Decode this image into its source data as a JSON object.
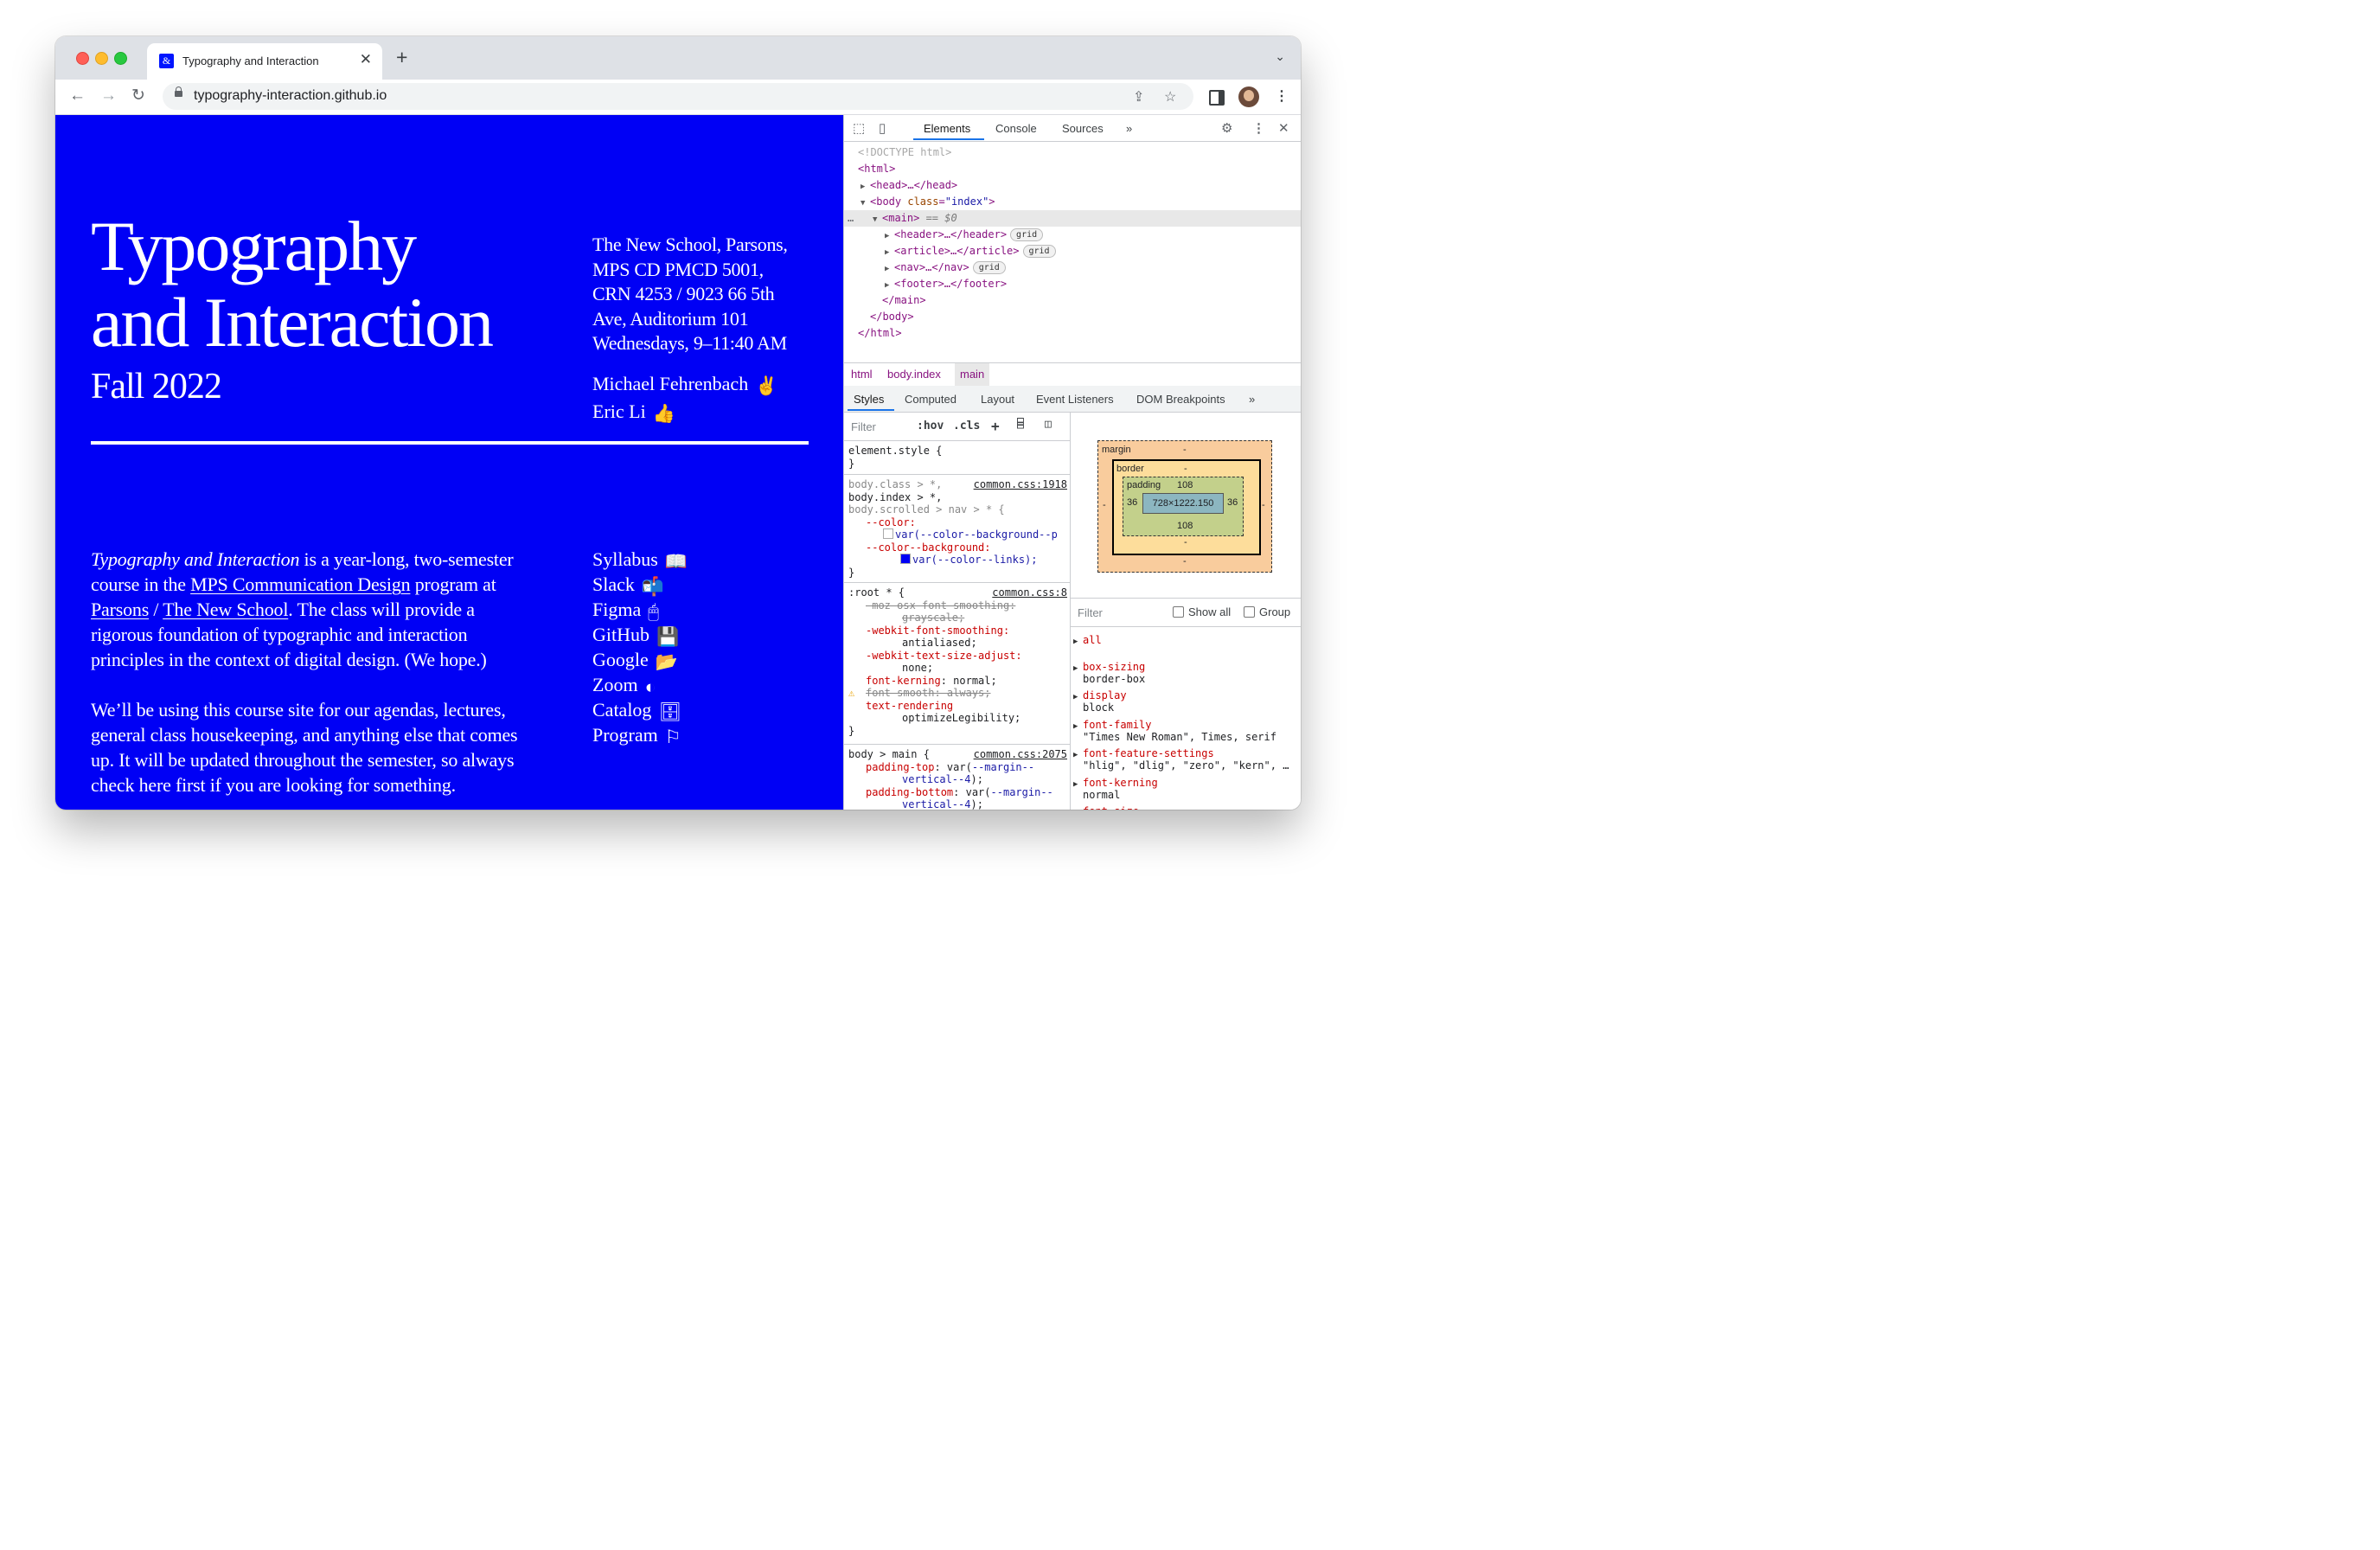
{
  "browser": {
    "tab_title": "Typography and Interaction",
    "tab_favicon": "&",
    "tab_close": "✕",
    "new_tab": "+",
    "tab_menu": "⌄",
    "url": "typography-interaction.github.io",
    "icons": [
      "back-icon",
      "forward-icon",
      "reload-icon",
      "lock-icon",
      "share-icon",
      "bookmark-star-icon",
      "sidebar-icon",
      "avatar",
      "kebab-menu-icon"
    ]
  },
  "page": {
    "title_line1": "Typography",
    "title_line2": "and Interaction",
    "subtitle": "Fall 2022",
    "info": [
      "The New School, Parsons,",
      "MPS CD PMCD 5001,",
      "CRN 4253 / 9023 66 5th",
      "Ave, Auditorium 101",
      "Wednesdays, 9–11:40 AM"
    ],
    "people": [
      {
        "name": "Michael Fehrenbach",
        "emoji": "✌"
      },
      {
        "name": "Eric Li",
        "emoji": "👍"
      }
    ],
    "intro": {
      "course_name": "Typography and Interaction",
      "t1": " is a year-long, two-semester course in the ",
      "link1": "MPS Communication Design",
      "t2": " program at ",
      "link2": "Parsons",
      "t3": " / ",
      "link3": "The New School",
      "t4": ". The class will provide a rigorous foundation of typographic and interaction principles in the context of digital design. (We hope.)",
      "p2": "We’ll be using this course site for our agendas, lectures, general class housekeeping, and anything else that comes up. It will be updated throughout the semester, so always check here first if you are looking for something."
    },
    "links": [
      {
        "label": "Syllabus",
        "emoji": "📖"
      },
      {
        "label": "Slack",
        "emoji": "📬"
      },
      {
        "label": "Figma",
        "emoji": "🖱"
      },
      {
        "label": "GitHub",
        "emoji": "💾"
      },
      {
        "label": "Google",
        "emoji": "📂"
      },
      {
        "label": "Zoom",
        "emoji": "◐"
      },
      {
        "label": "Catalog",
        "emoji": "🗄"
      },
      {
        "label": "Program",
        "emoji": "⚐"
      }
    ]
  },
  "devtools": {
    "tabs": [
      "Elements",
      "Console",
      "Sources",
      "»"
    ],
    "dom": {
      "doctype": "<!DOCTYPE html>",
      "html_open": "<html>",
      "head": "<head>…</head>",
      "body_open_tag": "<body ",
      "body_attr": "class",
      "body_val": "\"index\"",
      "body_close_bracket": ">",
      "main_open": "<main>",
      "main_ref": " == $0",
      "header": "<header>…</header>",
      "article": "<article>…</article>",
      "nav": "<nav>…</nav>",
      "footer": "<footer>…</footer>",
      "main_close": "</main>",
      "body_close": "</body>",
      "html_close": "</html>",
      "grid_badge": "grid",
      "ellipsis": "…"
    },
    "breadcrumbs": [
      "html",
      "body.index",
      "main"
    ],
    "style_tabs": [
      "Styles",
      "Computed",
      "Layout",
      "Event Listeners",
      "DOM Breakpoints",
      "»"
    ],
    "styles_filter_placeholder": "Filter",
    "hov": ":hov",
    "cls": ".cls",
    "rules": {
      "element_style": "element.style {",
      "close": "}",
      "r1_sel1": "body.class > *,",
      "r1_sel2": "body.index > *,",
      "r1_sel3": "body.scrolled > nav > * {",
      "r1_src": "common.css:1918",
      "r1_p1": "--color:",
      "r1_v1": "var(--color--background--p",
      "r1_p2": "--color--background:",
      "r1_v2": "var(--color--links);",
      "r2_sel": ":root * {",
      "r2_src": "common.css:8",
      "r2_p1": "-moz-osx-font-smoothing:",
      "r2_v1": "grayscale;",
      "r2_p2": "-webkit-font-smoothing:",
      "r2_v2": "antialiased;",
      "r2_p3": "-webkit-text-size-adjust:",
      "r2_v3": "none;",
      "r2_p4": "font-kerning",
      "r2_v4": ": normal;",
      "r2_p5": "font-smooth: always;",
      "r2_p6": "text-rendering",
      "r2_v6": "optimizeLegibility;",
      "r3_sel": "body > main {",
      "r3_src": "common.css:2075",
      "r3_p1": "padding-top",
      "r3_v1a": ": var(",
      "r3_v1b": "--margin--",
      "r3_v1c": "vertical--4",
      "r3_v1d": ");",
      "r3_p2": "padding-bottom",
      "r3_v2a": ": var(",
      "r3_v2b": "--margin--",
      "r3_v2c": "vertical--4",
      "r3_v2d": ");"
    },
    "box_model": {
      "margin_label": "margin",
      "border_label": "border",
      "padding_label": "padding",
      "dash": "-",
      "padding_top": "108",
      "padding_bottom": "108",
      "padding_left": "36",
      "padding_right": "36",
      "content": "728×1222.150"
    },
    "computed": {
      "filter_placeholder": "Filter",
      "show_all": "Show all",
      "group": "Group",
      "props": [
        {
          "name": "all",
          "value": ""
        },
        {
          "name": "box-sizing",
          "value": "border-box"
        },
        {
          "name": "display",
          "value": "block"
        },
        {
          "name": "font-family",
          "value": "\"Times New Roman\", Times, serif"
        },
        {
          "name": "font-feature-settings",
          "value": "\"hlig\", \"dlig\", \"zero\", \"kern\", …"
        },
        {
          "name": "font-kerning",
          "value": "normal"
        },
        {
          "name": "font-size",
          "value": ""
        }
      ]
    }
  },
  "colors": {
    "page_background": "#0000f5",
    "page_text": "#ffffff",
    "accent": "#1a73e8"
  }
}
